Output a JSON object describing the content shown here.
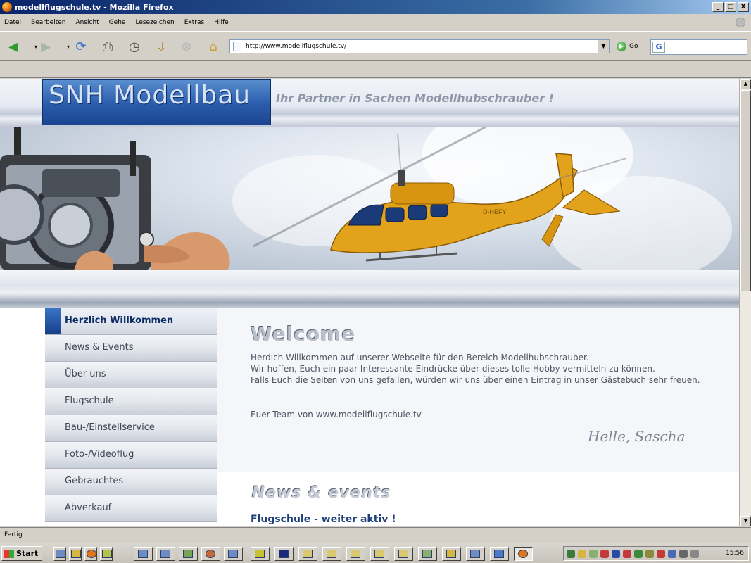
{
  "window": {
    "title": "modellflugschule.tv - Mozilla Firefox",
    "min_label": "_",
    "max_label": "□",
    "close_label": "X"
  },
  "menu": [
    "Datei",
    "Bearbeiten",
    "Ansicht",
    "Gehe",
    "Lesezeichen",
    "Extras",
    "Hilfe"
  ],
  "toolbar": {
    "url": "http://www.modellflugschule.tv/",
    "go_label": "Go",
    "search_value": ""
  },
  "page": {
    "logo": "SNH  Modellbau",
    "tagline": "Ihr Partner in Sachen Modellhubschrauber !",
    "nav": [
      "Herzlich Willkommen",
      "News & Events",
      "Über uns",
      "Flugschule",
      "Bau-/Einstellservice",
      "Foto-/Videoflug",
      "Gebrauchtes",
      "Abverkauf"
    ],
    "welcome_heading": "Welcome",
    "welcome_lines": [
      "Herdich Willkommen auf unserer Webseite für den Bereich Modellhubschrauber.",
      "Wir hoffen, Euch ein paar Interessante Eindrücke über dieses tolle Hobby vermitteln zu können.",
      "Falls Euch die Seiten von uns gefallen, würden wir uns über einen Eintrag in unser Gästebuch sehr freuen."
    ],
    "signoff": "Euer Team von www.modellflugschule.tv",
    "signature": "Helle, Sascha",
    "news_heading": "News  &  events",
    "news_item": "Flugschule - weiter aktiv !",
    "helicopter_reg": "D-HEFY"
  },
  "status": {
    "text": "Fertig"
  },
  "taskbar": {
    "start_label": "Start",
    "clock": "15:56"
  },
  "colors": {
    "logo_blue": "#2a5cab",
    "nav_active": "#0e2d66",
    "news_link": "#1e3f7a",
    "helicopter": "#e2a21c"
  }
}
